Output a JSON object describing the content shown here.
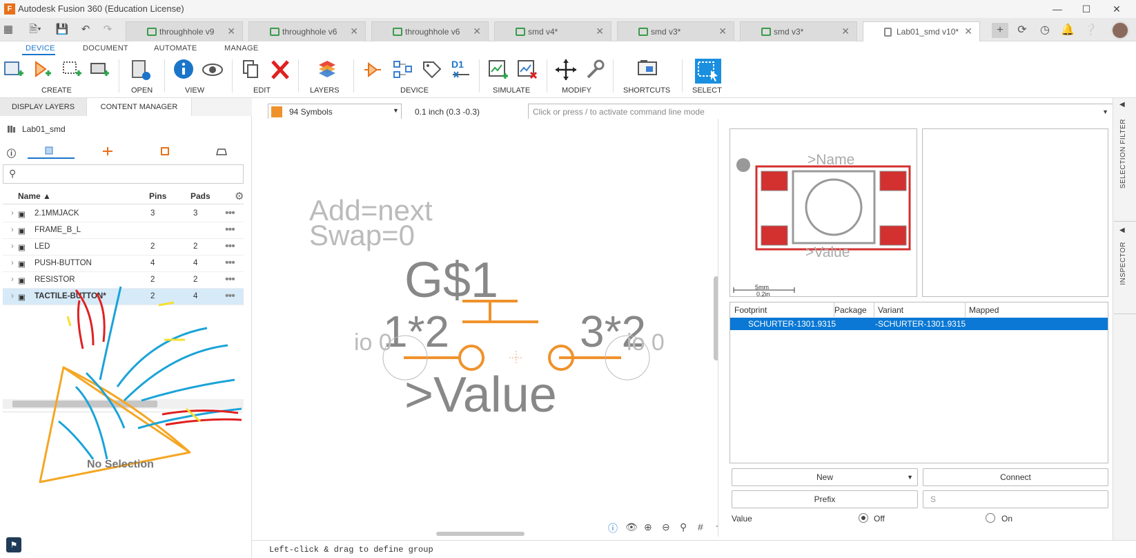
{
  "app": {
    "title": "Autodesk Fusion 360 (Education License)",
    "logo": "F"
  },
  "tabs": [
    {
      "label": "throughhole v9"
    },
    {
      "label": "throughhole v6"
    },
    {
      "label": "throughhole v6"
    },
    {
      "label": "smd v4*"
    },
    {
      "label": "smd v3*"
    },
    {
      "label": "smd v3*"
    },
    {
      "label": "Lab01_smd v10*"
    }
  ],
  "ribbon": {
    "tabs": [
      "DEVICE",
      "DOCUMENT",
      "AUTOMATE",
      "MANAGE"
    ],
    "groups": [
      "CREATE",
      "OPEN",
      "VIEW",
      "EDIT",
      "LAYERS",
      "DEVICE",
      "SIMULATE",
      "MODIFY",
      "SHORTCUTS",
      "SELECT"
    ]
  },
  "left_panel": {
    "tabs": [
      "DISPLAY LAYERS",
      "CONTENT MANAGER"
    ],
    "library_name": "Lab01_smd",
    "columns": [
      "Name",
      "Pins",
      "Pads"
    ],
    "rows": [
      {
        "name": "2.1MMJACK",
        "pins": "3",
        "pads": "3"
      },
      {
        "name": "FRAME_B_L",
        "pins": "",
        "pads": ""
      },
      {
        "name": "LED",
        "pins": "2",
        "pads": "2"
      },
      {
        "name": "PUSH-BUTTON",
        "pins": "4",
        "pads": "4"
      },
      {
        "name": "RESISTOR",
        "pins": "2",
        "pads": "2"
      },
      {
        "name": "TACTILE-BUTTON*",
        "pins": "2",
        "pads": "4"
      }
    ],
    "no_selection": "No Selection"
  },
  "toolbar2": {
    "symbol_count": "94 Symbols",
    "grid_readout": "0.1 inch (0.3 -0.3)",
    "command_placeholder": "Click or press / to activate command line mode"
  },
  "canvas": {
    "add_text": "Add=next",
    "swap_text": "Swap=0",
    "name_text": "G$1",
    "pin_left": "1*2",
    "pin_right": "3*2",
    "io_left": "io 0",
    "io_right": "io 0",
    "value_text": ">Value"
  },
  "footprint_preview": {
    "name_text": ">Name",
    "value_text": ">Value",
    "scale_mm": "5mm",
    "scale_in": "0.2in"
  },
  "variants": {
    "columns": [
      "Footprint",
      "Package",
      "Variant",
      "Mapped"
    ],
    "rows": [
      {
        "footprint": "SCHURTER-1301.9315",
        "variant": "-SCHURTER-1301.9315"
      }
    ]
  },
  "buttons": {
    "new": "New",
    "connect": "Connect",
    "prefix": "Prefix",
    "prefix_value": "S"
  },
  "value_setting": {
    "label": "Value",
    "off": "Off",
    "on": "On"
  },
  "right_sidebar": {
    "selection_filter": "SELECTION FILTER",
    "inspector": "INSPECTOR"
  },
  "status": {
    "hint": "Left-click & drag to define group"
  },
  "colors": {
    "accent": "#1a75c9",
    "symbol": "#f0922b",
    "pad": "#d33030",
    "selected_row": "#0a78d4"
  }
}
